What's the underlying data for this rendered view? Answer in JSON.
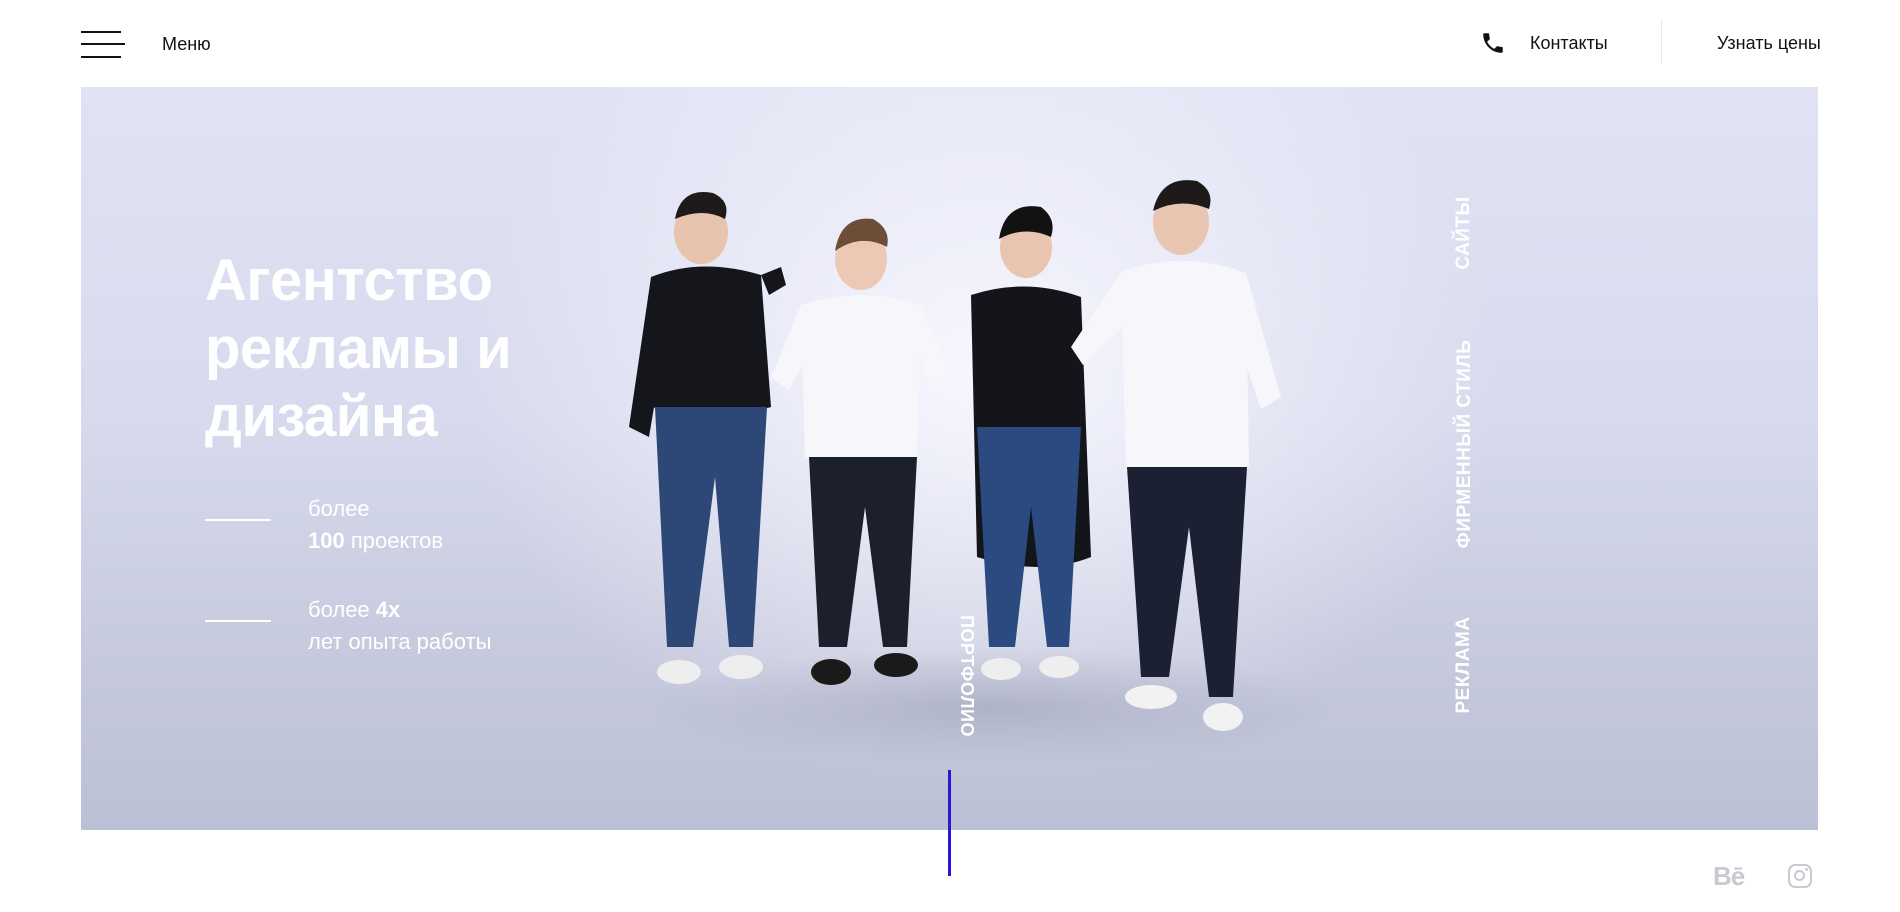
{
  "header": {
    "menu_label": "Меню",
    "contacts_label": "Контакты",
    "prices_label": "Узнать цены"
  },
  "hero": {
    "title": "Агентство рекламы и дизайна",
    "stats": [
      {
        "prefix": "более",
        "number": "100",
        "suffix": "проектов"
      },
      {
        "prefix": "более",
        "number": "4х",
        "suffix": "лет опыта работы"
      }
    ],
    "side_nav": [
      "САЙТЫ",
      "ФИРМЕННЫЙ СТИЛЬ",
      "РЕКЛАМА"
    ],
    "portfolio_label": "ПОРТФОЛИО"
  },
  "social": {
    "behance": "Bē"
  },
  "colors": {
    "accent": "#2a16d8",
    "hero_bg": "#d7daed",
    "icon_gray": "#c9c9d1"
  },
  "icons": [
    "burger-menu-icon",
    "phone-icon",
    "behance-icon",
    "instagram-icon"
  ]
}
